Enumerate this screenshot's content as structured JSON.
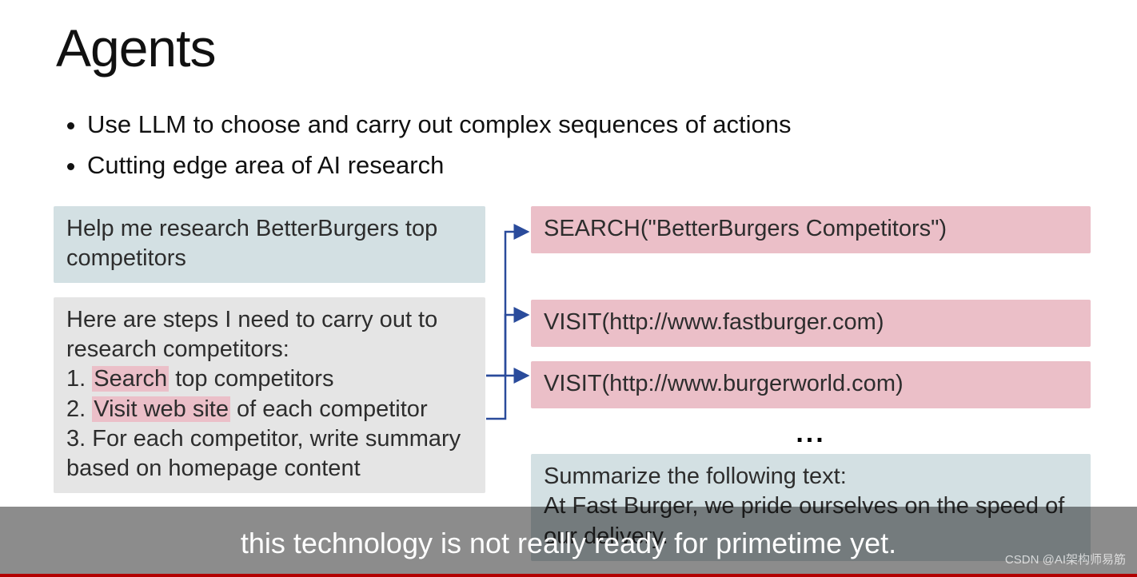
{
  "title": "Agents",
  "bullets": [
    "Use LLM to choose and carry out complex sequences of actions",
    "Cutting edge area of AI research"
  ],
  "left": {
    "prompt": "Help me research BetterBurgers top competitors",
    "plan": {
      "intro": "Here are steps I need to carry out to research competitors:",
      "s1_a": "1. ",
      "s1_hl": "Search",
      "s1_b": " top competitors",
      "s2_a": "2. ",
      "s2_hl": "Visit web site",
      "s2_b": " of each competitor",
      "s3": "3. For each competitor, write summary based on homepage content"
    }
  },
  "right": {
    "search": "SEARCH(\"BetterBurgers Competitors\")",
    "visit1": "VISIT(http://www.fastburger.com)",
    "visit2": "VISIT(http://www.burgerworld.com)",
    "ellipsis": "...",
    "summary_head": "Summarize the following text:",
    "summary_body": "At Fast Burger, we pride ourselves on the speed of our delivery."
  },
  "caption": "this technology is not really ready for primetime yet.",
  "watermark": "CSDN @AI架构师易筋"
}
